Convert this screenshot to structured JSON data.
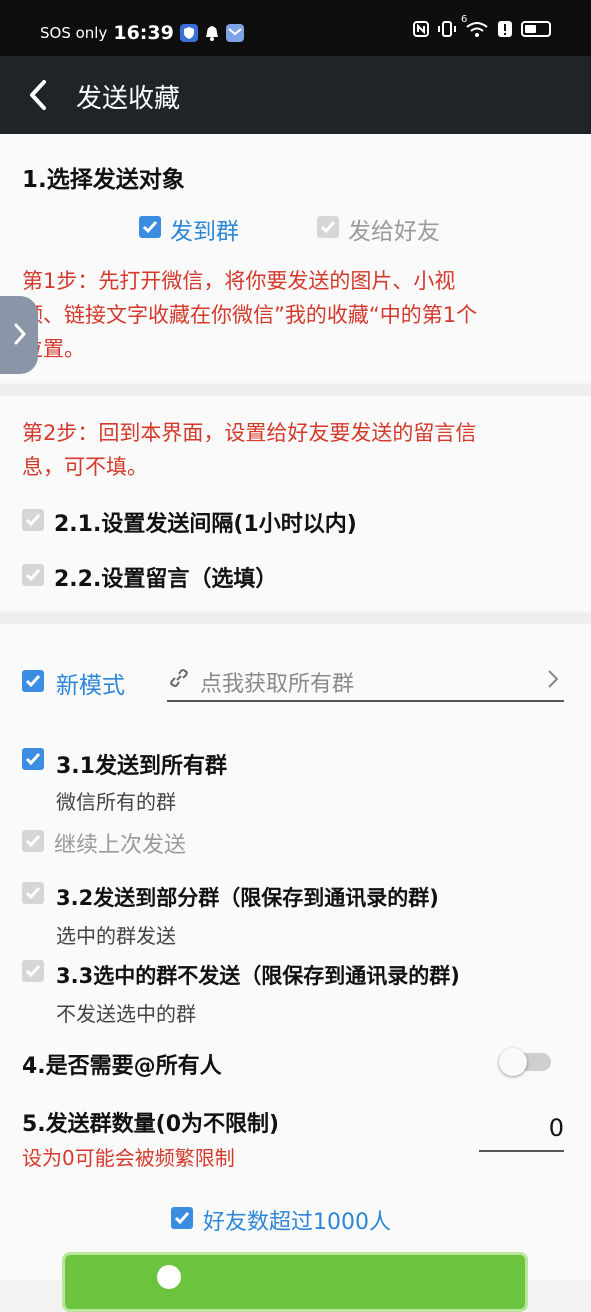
{
  "status_bar": {
    "carrier": "SOS only",
    "time": "16:39",
    "network": "6"
  },
  "app_bar": {
    "title": "发送收藏"
  },
  "section1": {
    "heading": "1.选择发送对象",
    "option_group": "发到群",
    "option_friend": "发给好友",
    "step1_text_line1": "第1步：先打开微信，将你要发送的图片、小视",
    "step1_text_line2": "频、链接文字收藏在你微信”我的收藏“中的第1个",
    "step1_text_line3": "位置。"
  },
  "section2": {
    "step2_text_line1": "第2步：回到本界面，设置给好友要发送的留言信",
    "step2_text_line2": "息，可不填。",
    "interval_label": "2.1.设置发送间隔(1小时以内)",
    "message_label": "2.2.设置留言（选填）"
  },
  "section3": {
    "new_mode_label": "新模式",
    "fetch_groups_placeholder": "点我获取所有群",
    "all_groups_label": "3.1发送到所有群",
    "all_groups_sub": "微信所有的群",
    "continue_label": "继续上次发送",
    "some_groups_label": "3.2发送到部分群（限保存到通讯录的群)",
    "some_groups_sub": "选中的群发送",
    "exclude_label": "3.3选中的群不发送（限保存到通讯录的群)",
    "exclude_sub": "不发送选中的群",
    "at_all_label": "4.是否需要@所有人",
    "group_count_label": "5.发送群数量(0为不限制)",
    "group_count_warning": "设为0可能会被频繁限制",
    "group_count_value": "0",
    "over_1000_label": "好友数超过1000人"
  },
  "colors": {
    "accent_blue": "#3a8de0",
    "warning_red": "#d33a2c",
    "start_button": "#6cc33e"
  }
}
